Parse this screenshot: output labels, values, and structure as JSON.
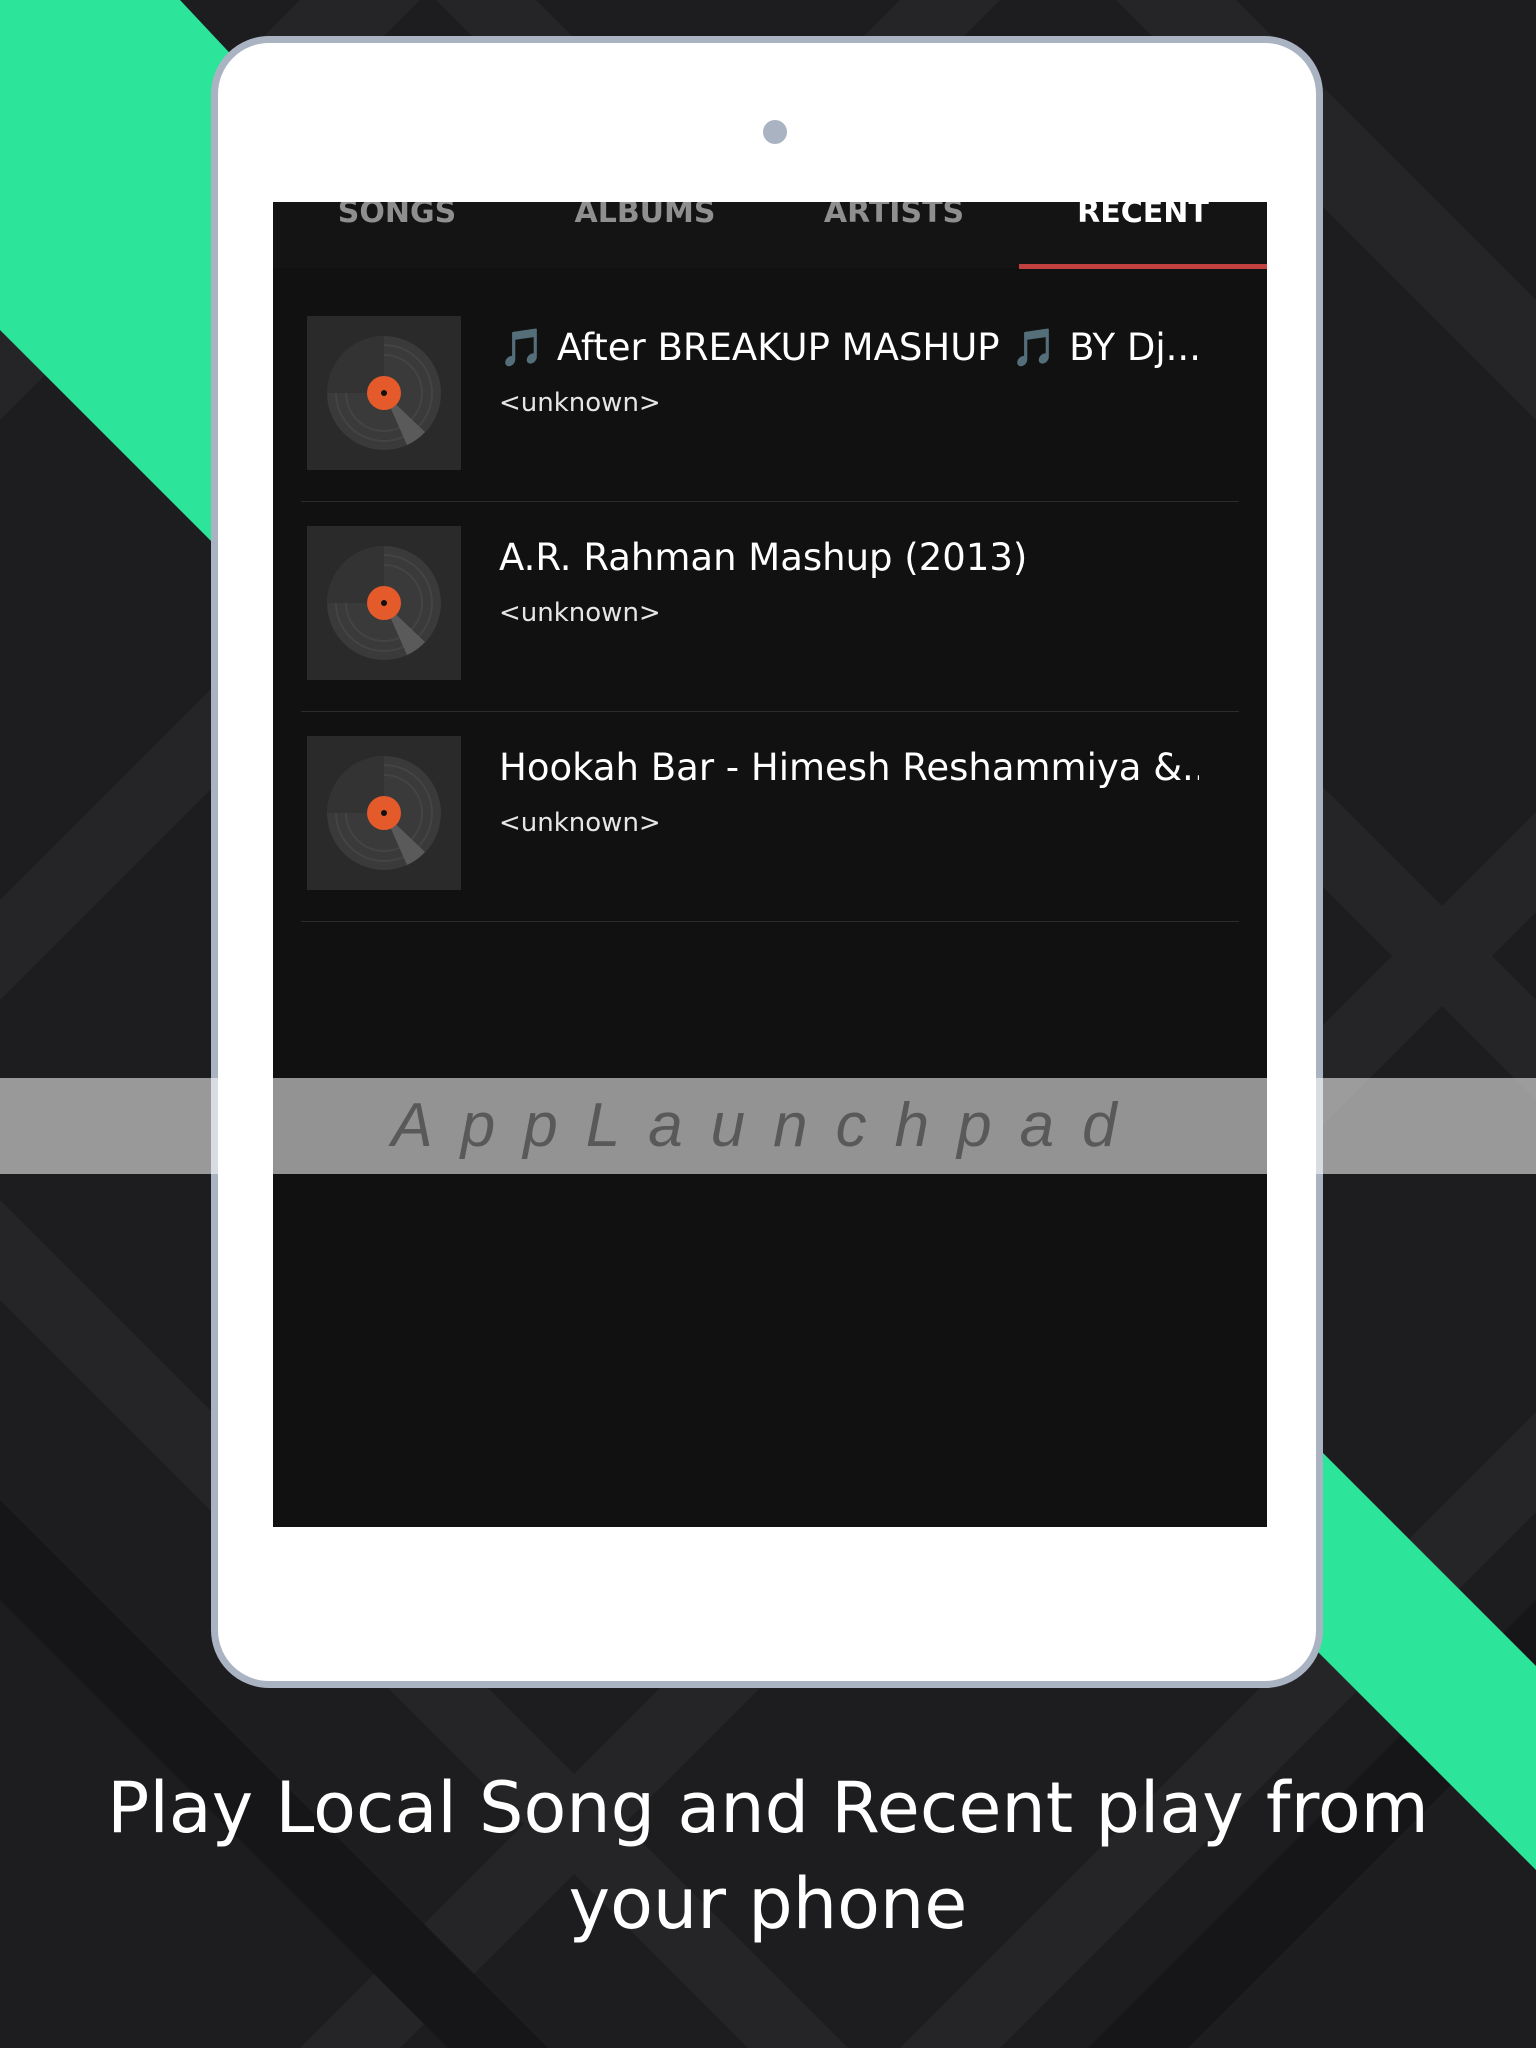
{
  "colors": {
    "accent_green": "#2ce59a",
    "tab_indicator": "#c0413f",
    "record_label": "#e45a2a",
    "screen_bg": "#111111"
  },
  "tabs": [
    {
      "label": "SONGS",
      "active": false
    },
    {
      "label": "ALBUMS",
      "active": false
    },
    {
      "label": "ARTISTS",
      "active": false
    },
    {
      "label": "RECENT",
      "active": true
    }
  ],
  "recent_songs": [
    {
      "title": "🎵 After BREAKUP MASHUP 🎵 BY Dj...",
      "artist": "<unknown>",
      "icon": "vinyl-record-icon"
    },
    {
      "title": "A.R. Rahman Mashup (2013)",
      "artist": "<unknown>",
      "icon": "vinyl-record-icon"
    },
    {
      "title": "Hookah Bar - Himesh Reshammiya &...",
      "artist": "<unknown>",
      "icon": "vinyl-record-icon"
    }
  ],
  "watermark": "AppLaunchpad",
  "caption": "Play Local Song and Recent play from your phone"
}
